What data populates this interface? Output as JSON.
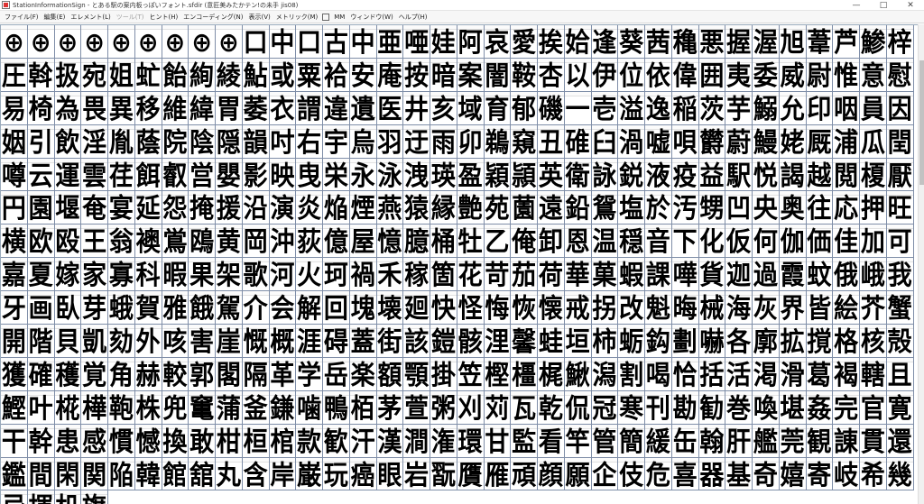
{
  "window": {
    "title": "StationInformationSign - とある駅の案内板っぽいフォント.sfdir (意匠美みたかテン!の未手 jis08)",
    "minimize": "—",
    "maximize": "□",
    "close": "✕"
  },
  "menu": [
    {
      "label": "ファイル(F)",
      "enabled": true
    },
    {
      "label": "編集(E)",
      "enabled": true
    },
    {
      "label": "エレメント(L)",
      "enabled": true
    },
    {
      "label": "ツール(T)",
      "enabled": false
    },
    {
      "label": "ヒント(H)",
      "enabled": true
    },
    {
      "label": "エンコーディング(N)",
      "enabled": true
    },
    {
      "label": "表示(V)",
      "enabled": true
    },
    {
      "label": "メトリック(M)",
      "enabled": true
    },
    {
      "label": "MM",
      "enabled": true
    },
    {
      "label": "ウィンドウ(W)",
      "enabled": true
    },
    {
      "label": "ヘルプ(H)",
      "enabled": true
    }
  ],
  "glyph_rows": [
    "⊕⊕⊕⊕⊕⊕⊕⊕⊕口中口古中亜唖娃阿哀愛挨姶逢葵茜穐悪握渥旭葦芦鯵梓圧斡扱宛",
    "姐虻飴絢綾鮎或粟袷安庵按暗案闇鞍杏以伊位依偉囲夷委威尉惟意慰易椅為畏",
    "異移維緯胃萎衣謂違遺医井亥域育郁磯一壱溢逸稲茨芋鰯允印咽員因姻引飲淫",
    "胤蔭院陰隠韻吋右宇烏羽迂雨卯鵜窺丑碓臼渦嘘唄欝蔚鰻姥厩浦瓜閏噂云運雲",
    "荏餌叡営嬰影映曳栄永泳洩瑛盈穎頴英衛詠鋭液疫益駅悦謁越閲榎厭円園堰奄",
    "宴延怨掩援沿演炎焔煙燕猿縁艶苑薗遠鉛鴛塩於汚甥凹央奥往応押旺横欧殴王",
    "翁襖鴬鴎黄岡沖荻億屋憶臆桶牡乙俺卸恩温穏音下化仮何伽価佳加可嘉夏嫁家",
    "寡科暇果架歌河火珂禍禾稼箇花苛茄荷華菓蝦課嘩貨迦過霞蚊俄峨我牙画臥芽",
    "蛾賀雅餓駕介会解回塊壊廻快怪悔恢懐戒拐改魁晦械海灰界皆絵芥蟹開階貝凱",
    "劾外咳害崖慨概涯碍蓋街該鎧骸浬馨蛙垣柿蛎鈎劃嚇各廓拡撹格核殻獲確穫覚",
    "角赫較郭閣隔革学岳楽額顎掛笠樫橿梶鰍潟割喝恰括活渇滑葛褐轄且鰹叶椛樺",
    "鞄株兜竃蒲釜鎌噛鴨栢茅萱粥刈苅瓦乾侃冠寒刊勘勧巻喚堪姦完官寛干幹患感",
    "慣憾換敢柑桓棺款歓汗漢澗潅環甘監看竿管簡緩缶翰肝艦莞観諌貫還鑑間閑関",
    "陥韓館舘丸含岸巌玩癌眼岩翫贋雁頑顔願企伎危喜器基奇嬉寄岐希幾忌揮机旗"
  ],
  "scrollbar": {
    "thumb_fraction": 0.26
  }
}
